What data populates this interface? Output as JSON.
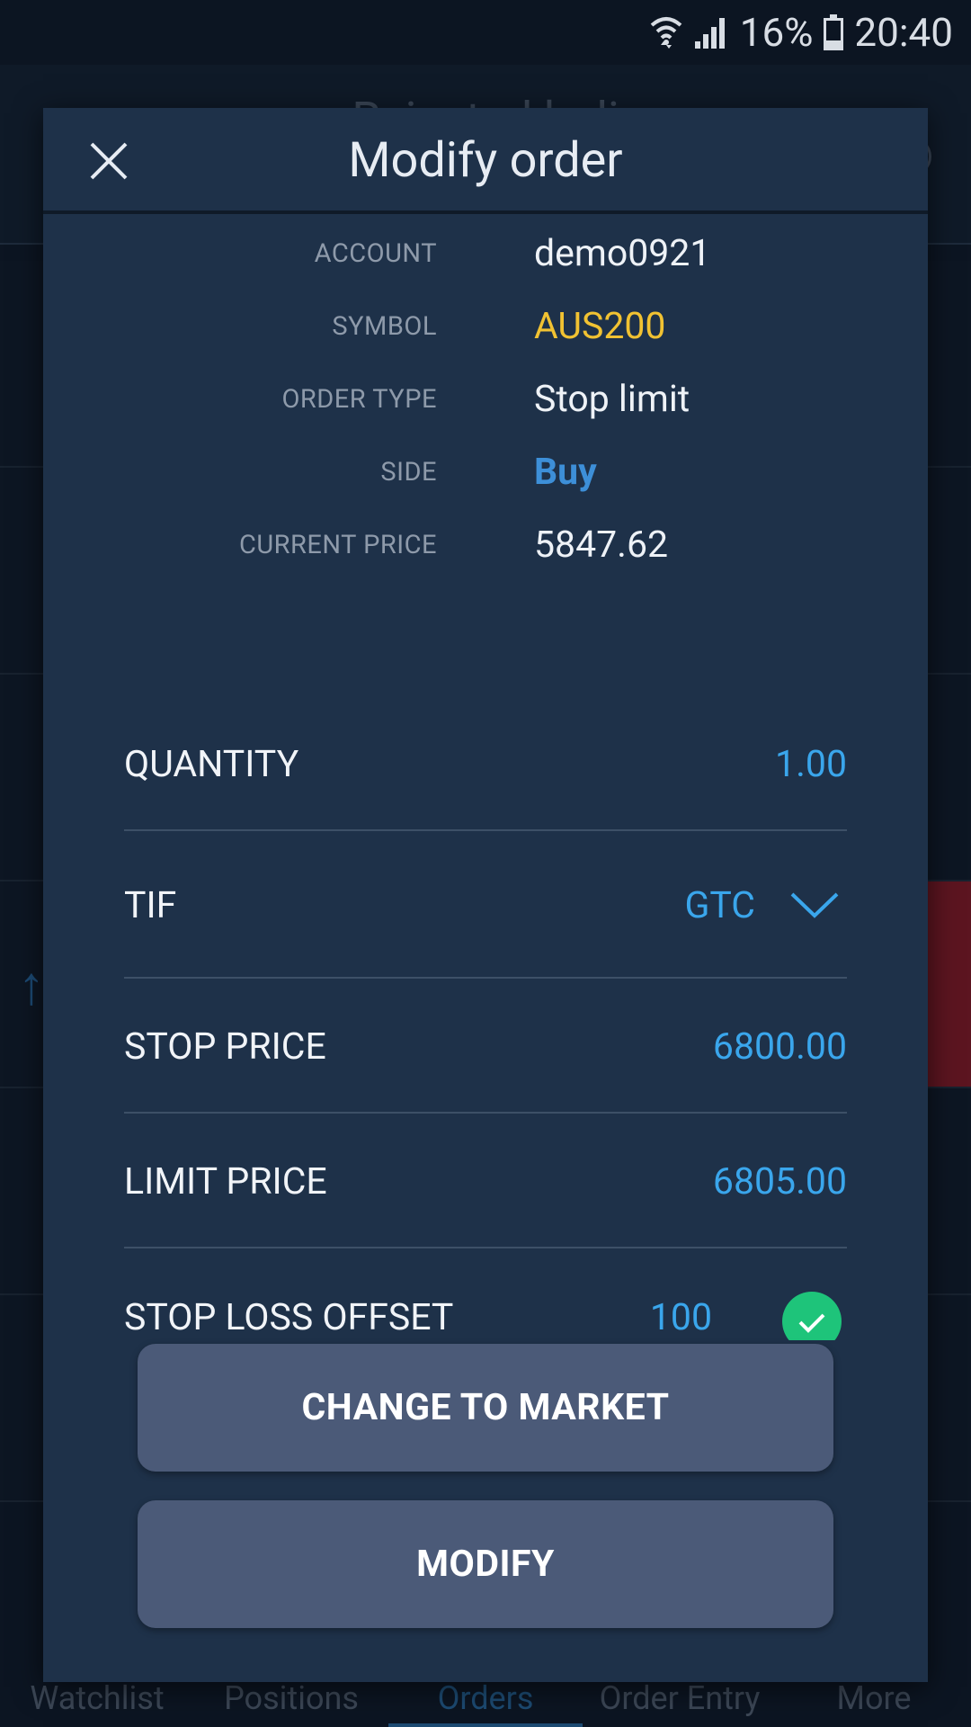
{
  "status_bar": {
    "battery": "16%",
    "time": "20:40",
    "icons": [
      "wifi-icon",
      "signal-icon",
      "battery-icon"
    ]
  },
  "background": {
    "title": "Rejected holi"
  },
  "modal": {
    "title": "Modify order",
    "close_icon": "close-icon",
    "info": {
      "account_label": "ACCOUNT",
      "account_value": "demo0921",
      "symbol_label": "SYMBOL",
      "symbol_value": "AUS200",
      "order_type_label": "ORDER TYPE",
      "order_type_value": "Stop limit",
      "side_label": "SIDE",
      "side_value": "Buy",
      "current_price_label": "CURRENT PRICE",
      "current_price_value": "5847.62"
    },
    "fields": {
      "quantity_label": "QUANTITY",
      "quantity_value": "1.00",
      "tif_label": "TIF",
      "tif_value": "GTC",
      "stop_price_label": "STOP PRICE",
      "stop_price_value": "6800.00",
      "limit_price_label": "LIMIT PRICE",
      "limit_price_value": "6805.00",
      "stop_loss_offset_label": "STOP LOSS OFFSET",
      "stop_loss_offset_value": "100",
      "stop_loss_offset_enabled": true
    },
    "buttons": {
      "change_to_market": "CHANGE TO MARKET",
      "modify": "MODIFY"
    }
  },
  "bottom_nav": {
    "items": [
      "Watchlist",
      "Positions",
      "Orders",
      "Order Entry",
      "More"
    ],
    "active": "Orders"
  },
  "colors": {
    "modal_bg": "#1e3149",
    "accent_blue": "#3aa6ec",
    "symbol_yellow": "#f1c232",
    "side_blue": "#3d8fd8",
    "button_bg": "#4b5a78",
    "check_green": "#1ec47a"
  }
}
